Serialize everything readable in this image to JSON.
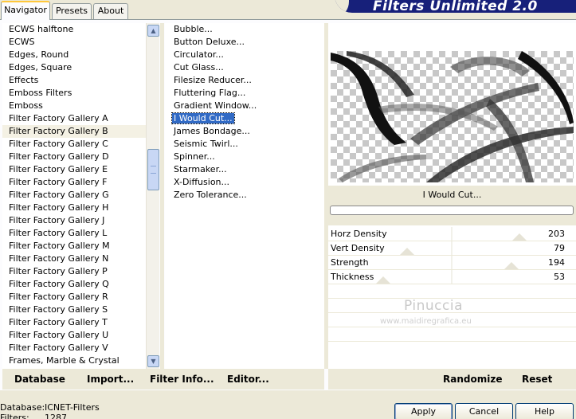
{
  "tabs": [
    {
      "label": "Navigator",
      "active": true
    },
    {
      "label": "Presets",
      "active": false
    },
    {
      "label": "About",
      "active": false
    }
  ],
  "app_title": "Filters Unlimited 2.0",
  "categories": [
    "ECWS halftone",
    "ECWS",
    "Edges, Round",
    "Edges, Square",
    "Effects",
    "Emboss Filters",
    "Emboss",
    "Filter Factory Gallery A",
    "Filter Factory Gallery B",
    "Filter Factory Gallery C",
    "Filter Factory Gallery D",
    "Filter Factory Gallery E",
    "Filter Factory Gallery F",
    "Filter Factory Gallery G",
    "Filter Factory Gallery H",
    "Filter Factory Gallery J",
    "Filter Factory Gallery L",
    "Filter Factory Gallery M",
    "Filter Factory Gallery N",
    "Filter Factory Gallery P",
    "Filter Factory Gallery Q",
    "Filter Factory Gallery R",
    "Filter Factory Gallery S",
    "Filter Factory Gallery T",
    "Filter Factory Gallery U",
    "Filter Factory Gallery V",
    "Frames, Marble & Crystal"
  ],
  "selected_category": "Filter Factory Gallery B",
  "filters": [
    "Bubble...",
    "Button Deluxe...",
    "Circulator...",
    "Cut Glass...",
    "Filesize Reducer...",
    "Fluttering Flag...",
    "Gradient Window...",
    "I Would Cut...",
    "James Bondage...",
    "Seismic Twirl...",
    "Spinner...",
    "Starmaker...",
    "X-Diffusion...",
    "Zero Tolerance..."
  ],
  "selected_filter": "I Would Cut...",
  "current_filter_name": "I Would Cut...",
  "progress": 0,
  "params": [
    {
      "label": "Horz Density",
      "value": "203",
      "level": 0.796
    },
    {
      "label": "Vert Density",
      "value": "79",
      "level": 0.31
    },
    {
      "label": "Strength",
      "value": "194",
      "level": 0.761
    },
    {
      "label": "Thickness",
      "value": "53",
      "level": 0.208
    }
  ],
  "watermark": {
    "line1": "Pinuccia",
    "line2": "www.maidiregrafica.eu"
  },
  "bottom_left": {
    "database": "Database",
    "import": "Import...",
    "filter_info": "Filter Info...",
    "editor": "Editor..."
  },
  "bottom_right": {
    "randomize": "Randomize",
    "reset": "Reset"
  },
  "status": {
    "db_key": "Database:",
    "db_val": "ICNET-Filters",
    "filters_key": "Filters:",
    "filters_val": "1287"
  },
  "dialog": {
    "apply": "Apply",
    "cancel": "Cancel",
    "help": "Help"
  }
}
